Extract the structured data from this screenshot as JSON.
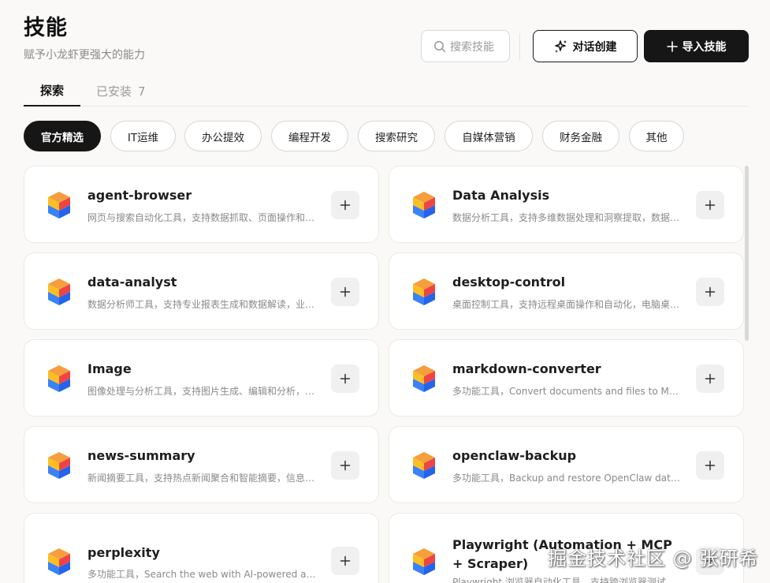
{
  "header": {
    "title": "技能",
    "subtitle": "赋予小龙虾更强大的能力"
  },
  "search": {
    "placeholder": "搜索技能"
  },
  "actions": {
    "chat_create": "对话创建",
    "import_skill": "导入技能"
  },
  "tabs": [
    {
      "label": "探索"
    },
    {
      "label": "已安装",
      "count": "7"
    }
  ],
  "categories": [
    "官方精选",
    "IT运维",
    "办公提效",
    "编程开发",
    "搜索研究",
    "自媒体营销",
    "财务金融",
    "其他"
  ],
  "skills": [
    {
      "name": "agent-browser",
      "desc": "网页与搜索自动化工具，支持数据抓取、页面操作和…"
    },
    {
      "name": "Data Analysis",
      "desc": "数据分析工具，支持多维数据处理和洞察提取，数据…"
    },
    {
      "name": "data-analyst",
      "desc": "数据分析师工具，支持专业报表生成和数据解读，业…"
    },
    {
      "name": "desktop-control",
      "desc": "桌面控制工具，支持远程桌面操作和自动化，电脑桌…"
    },
    {
      "name": "Image",
      "desc": "图像处理与分析工具，支持图片生成、编辑和分析，…"
    },
    {
      "name": "markdown-converter",
      "desc": "多功能工具，Convert documents and files to Mark…"
    },
    {
      "name": "news-summary",
      "desc": "新闻摘要工具，支持热点新闻聚合和智能摘要，信息…"
    },
    {
      "name": "openclaw-backup",
      "desc": "多功能工具，Backup and restore OpenClaw data. …"
    },
    {
      "name": "perplexity",
      "desc": "多功能工具，Search the web with AI-powered ans…"
    },
    {
      "name": "Playwright (Automation + MCP + Scraper)",
      "desc": "Playwright 浏览器自动化工具，支持跨浏览器测试和…"
    }
  ],
  "watermark": "掘金技术社区 @ 张研希",
  "colors": {
    "background": "#faf9f7",
    "primary": "#161616",
    "logo_orange": "#f59e3c",
    "logo_red": "#ef4444",
    "logo_blue": "#3b82f6"
  }
}
